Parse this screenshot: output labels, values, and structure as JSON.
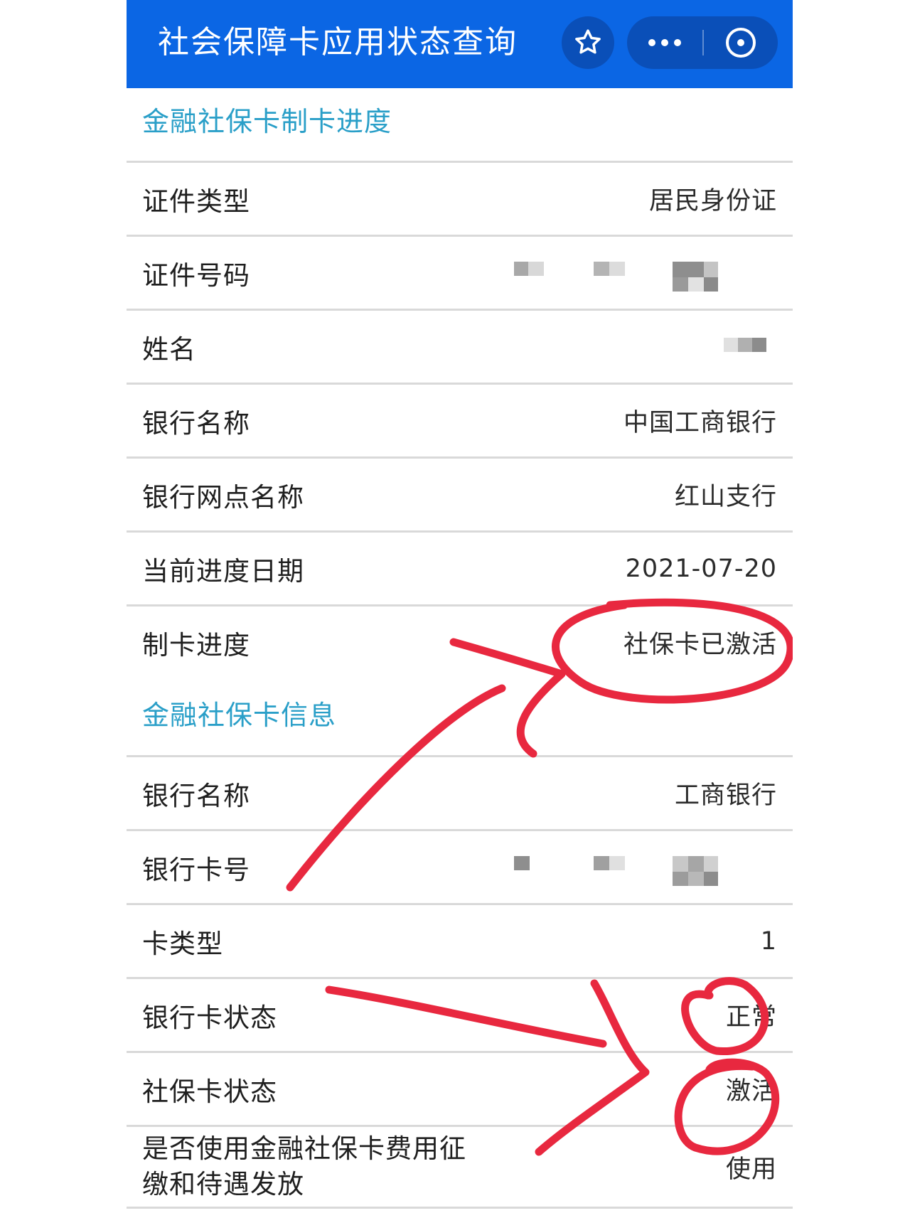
{
  "header": {
    "title": "社会保障卡应用状态查询",
    "favorite_icon": "star-icon",
    "more_icon": "more-dots-icon",
    "close_icon": "close-circle-icon",
    "background_color": "#0b66e4"
  },
  "progress_section": {
    "title": "金融社保卡制卡进度",
    "rows": [
      {
        "label": "证件类型",
        "value": "居民身份证"
      },
      {
        "label": "证件号码",
        "value": ""
      },
      {
        "label": "姓名",
        "value": ""
      },
      {
        "label": "银行名称",
        "value": "中国工商银行"
      },
      {
        "label": "银行网点名称",
        "value": "红山支行"
      },
      {
        "label": "当前进度日期",
        "value": "2021-07-20"
      },
      {
        "label": "制卡进度",
        "value": "社保卡已激活"
      }
    ]
  },
  "info_section": {
    "title": "金融社保卡信息",
    "rows": [
      {
        "label": "银行名称",
        "value": "工商银行"
      },
      {
        "label": "银行卡号",
        "value": ""
      },
      {
        "label": "卡类型",
        "value": "1"
      },
      {
        "label": "银行卡状态",
        "value": "正常"
      },
      {
        "label": "社保卡状态",
        "value": "激活"
      },
      {
        "label_line1": "是否使用金融社保卡费用征",
        "label_line2": "缴和待遇发放",
        "value": "使用"
      }
    ]
  },
  "colors": {
    "section_title": "#2a9fc8",
    "annotation_red": "#e8283f"
  }
}
